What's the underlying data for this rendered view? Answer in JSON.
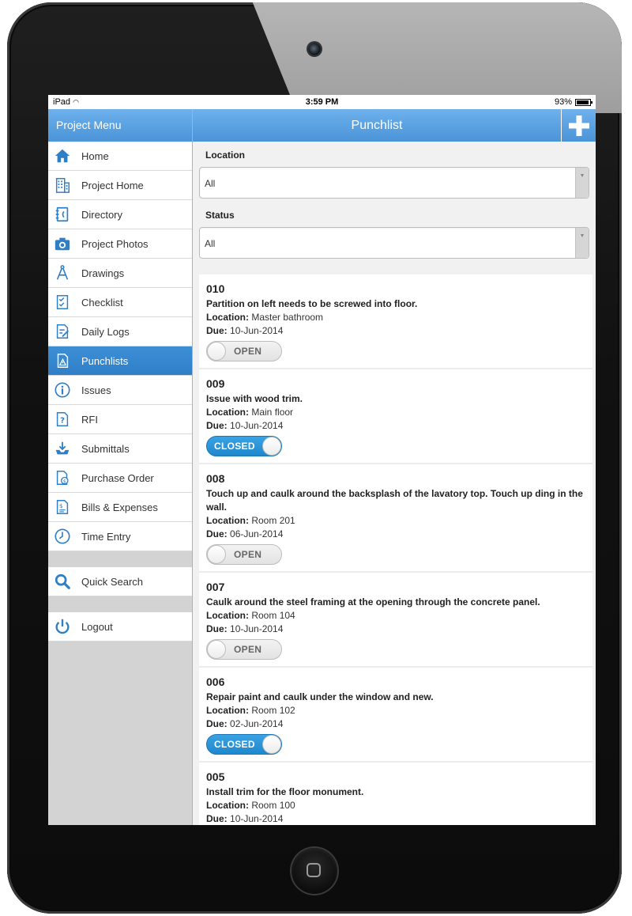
{
  "status_bar": {
    "device": "iPad",
    "time": "3:59 PM",
    "battery": "93%"
  },
  "sidebar": {
    "title": "Project Menu",
    "items": [
      {
        "label": "Home",
        "icon": "home-icon"
      },
      {
        "label": "Project Home",
        "icon": "building-icon"
      },
      {
        "label": "Directory",
        "icon": "directory-icon"
      },
      {
        "label": "Project Photos",
        "icon": "camera-icon"
      },
      {
        "label": "Drawings",
        "icon": "compass-icon"
      },
      {
        "label": "Checklist",
        "icon": "checklist-icon"
      },
      {
        "label": "Daily Logs",
        "icon": "daily-log-icon"
      },
      {
        "label": "Punchlists",
        "icon": "punchlist-icon",
        "active": true
      },
      {
        "label": "Issues",
        "icon": "info-icon"
      },
      {
        "label": "RFI",
        "icon": "question-doc-icon"
      },
      {
        "label": "Submittals",
        "icon": "download-tray-icon"
      },
      {
        "label": "Purchase Order",
        "icon": "purchase-order-icon"
      },
      {
        "label": "Bills & Expenses",
        "icon": "bill-icon"
      },
      {
        "label": "Time Entry",
        "icon": "clock-icon"
      }
    ],
    "quick_search": "Quick Search",
    "logout": "Logout"
  },
  "main": {
    "title": "Punchlist",
    "add_icon": "plus-icon",
    "filters": {
      "location_label": "Location",
      "location_value": "All",
      "status_label": "Status",
      "status_value": "All"
    },
    "location_prefix": "Location:",
    "due_prefix": "Due:",
    "items": [
      {
        "number": "010",
        "description": "Partition on left needs to be screwed into floor.",
        "location": "Master bathroom",
        "due": "10-Jun-2014",
        "status": "OPEN"
      },
      {
        "number": "009",
        "description": "Issue with wood trim.",
        "location": "Main floor",
        "due": "10-Jun-2014",
        "status": "CLOSED"
      },
      {
        "number": "008",
        "description": "Touch up and caulk around the backsplash of the lavatory top. Touch up ding in the wall.",
        "location": "Room 201",
        "due": "06-Jun-2014",
        "status": "OPEN"
      },
      {
        "number": "007",
        "description": "Caulk around the steel framing at the opening through the concrete panel.",
        "location": "Room 104",
        "due": "10-Jun-2014",
        "status": "OPEN"
      },
      {
        "number": "006",
        "description": "Repair paint and caulk under the window and new.",
        "location": "Room 102",
        "due": "02-Jun-2014",
        "status": "CLOSED"
      },
      {
        "number": "005",
        "description": "Install trim for the floor monument.",
        "location": "Room 100",
        "due": "10-Jun-2014",
        "status": ""
      }
    ]
  },
  "colors": {
    "accent": "#4a94d8",
    "active_item": "#3487cf",
    "toggle_on": "#2a93d6"
  }
}
